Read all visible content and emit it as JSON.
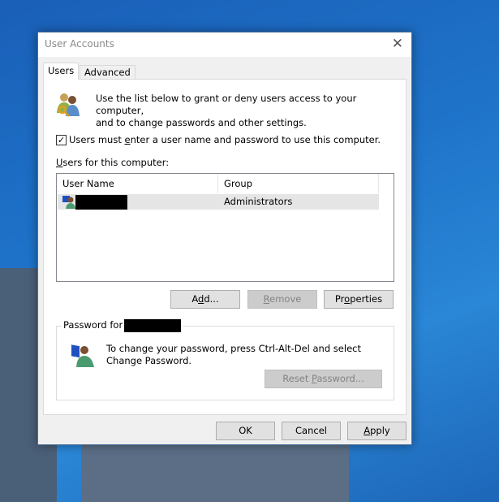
{
  "dialog": {
    "title": "User Accounts",
    "close_icon": "close-icon"
  },
  "tabs": [
    {
      "label": "Users",
      "active": true
    },
    {
      "label": "Advanced",
      "active": false
    }
  ],
  "intro": {
    "line1": "Use the list below to grant or deny users access to your computer,",
    "line2": "and to change passwords and other settings."
  },
  "require_password": {
    "checked": true,
    "label_pre": "Users must ",
    "label_u": "e",
    "label_post": "nter a user name and password to use this computer."
  },
  "users_label": {
    "u": "U",
    "rest": "sers for this computer:"
  },
  "list": {
    "columns": [
      "User Name",
      "Group"
    ],
    "rows": [
      {
        "user": "[redacted]",
        "group": "Administrators"
      }
    ]
  },
  "buttons": {
    "add": {
      "pre": "A",
      "u": "d",
      "post": "d..."
    },
    "remove": {
      "pre": "",
      "u": "R",
      "post": "emove"
    },
    "properties": {
      "pre": "Pr",
      "u": "o",
      "post": "perties"
    },
    "reset": {
      "pre": "Reset ",
      "u": "P",
      "post": "assword..."
    },
    "ok": "OK",
    "cancel": "Cancel",
    "apply": {
      "pre": "",
      "u": "A",
      "post": "pply"
    }
  },
  "password_group": {
    "label": "Password for",
    "message": "To change your password, press Ctrl-Alt-Del and select Change Password."
  }
}
